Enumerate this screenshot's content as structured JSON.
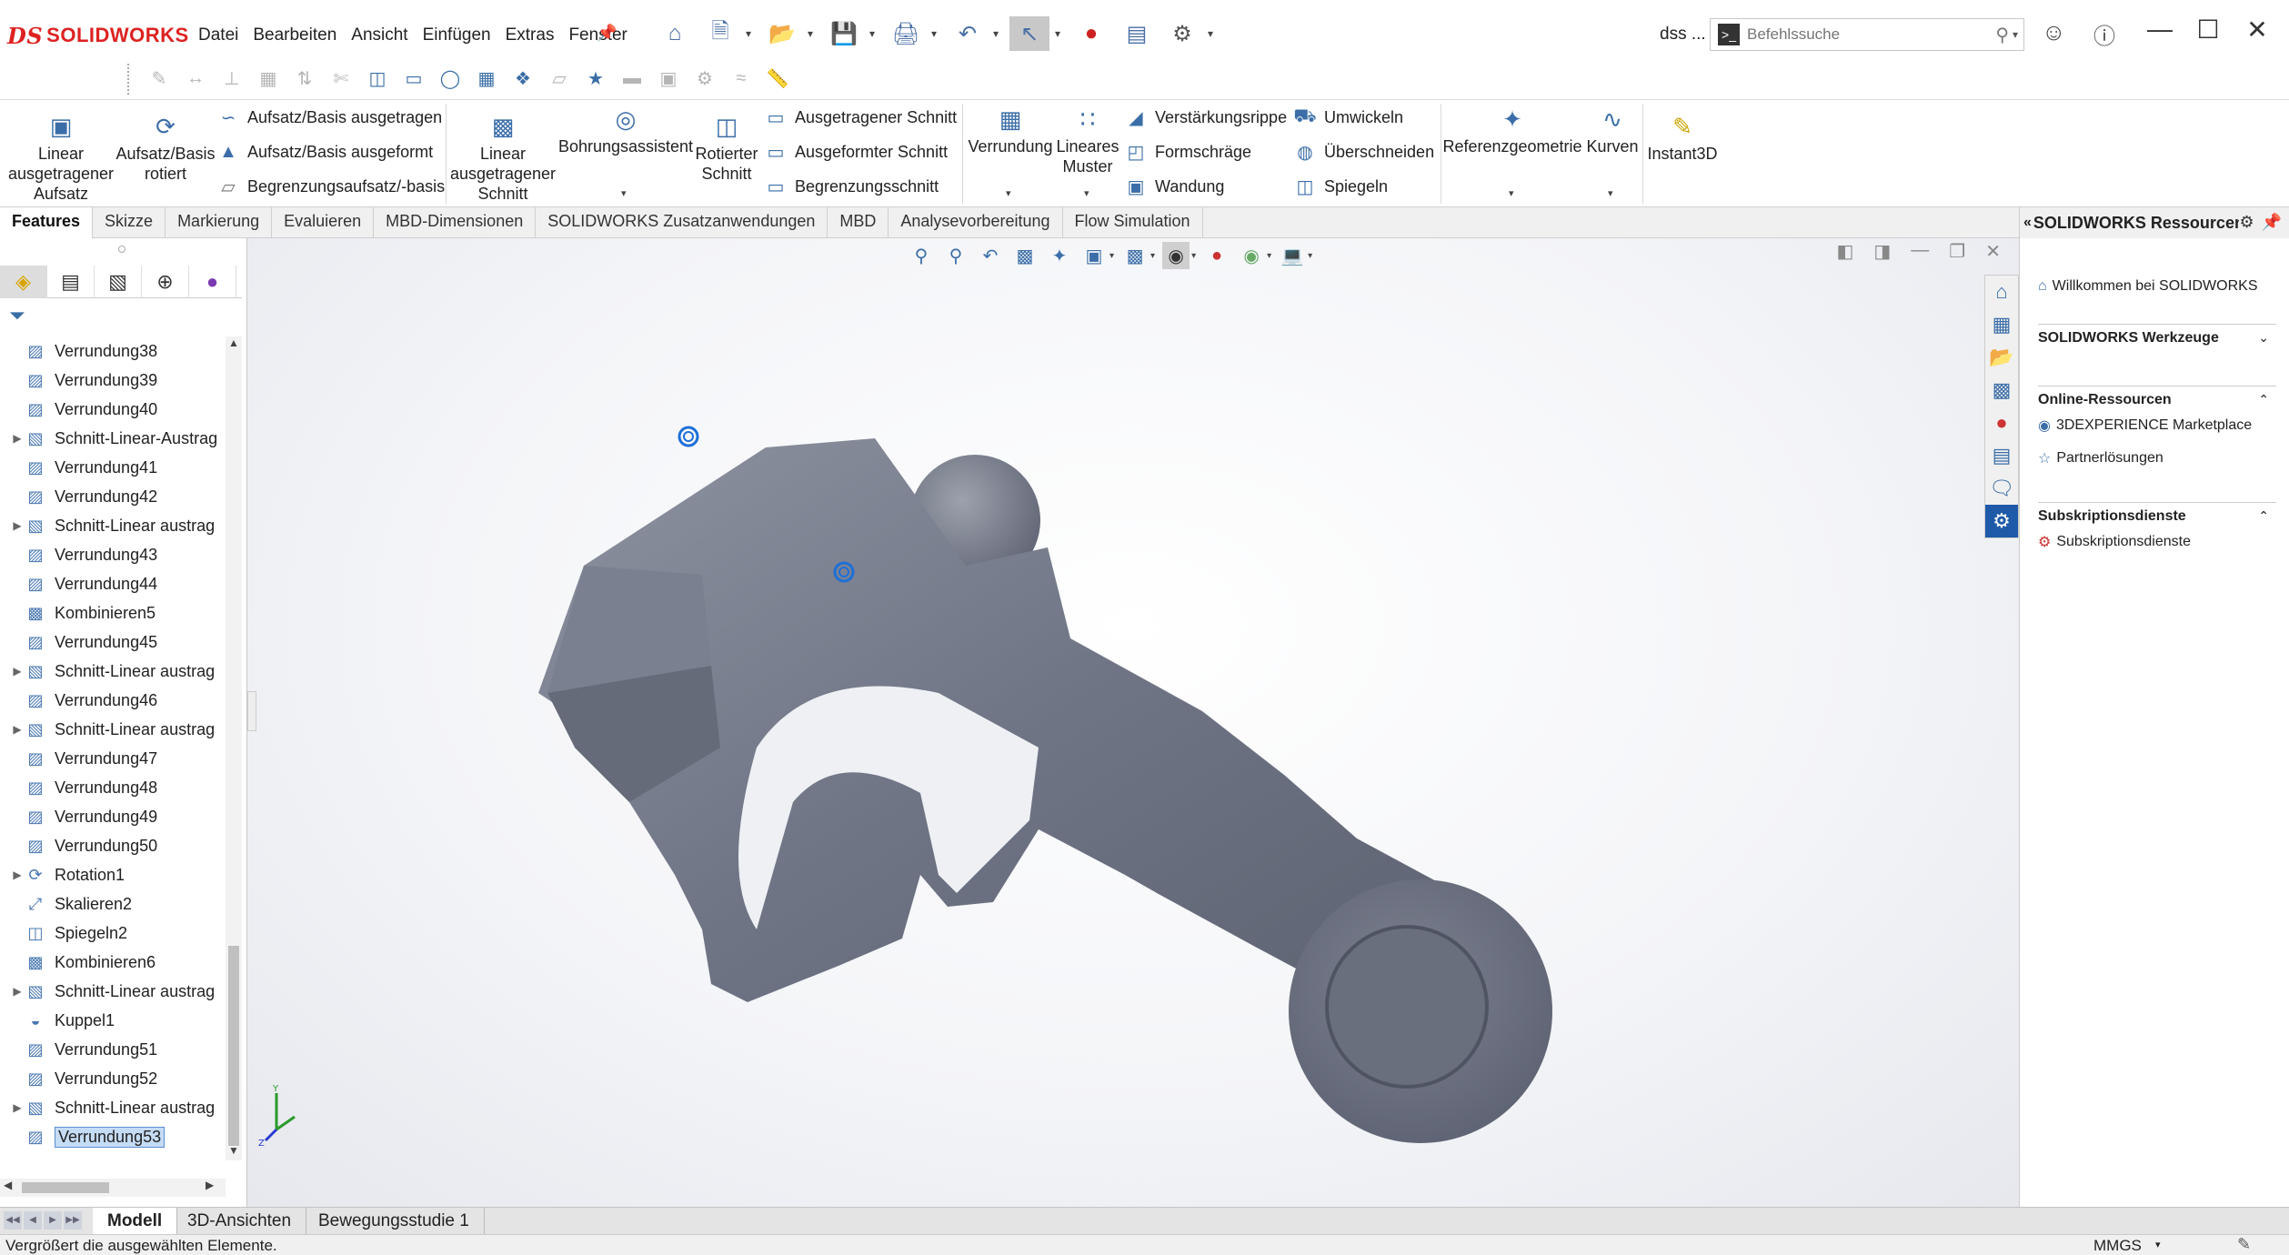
{
  "app": {
    "logo_text": "SOLIDWORKS",
    "menu": [
      "Datei",
      "Bearbeiten",
      "Ansicht",
      "Einfügen",
      "Extras",
      "Fenster"
    ],
    "user_label": "dss ...",
    "search": {
      "placeholder": "Befehlssuche"
    }
  },
  "ribbon": {
    "linear_extrude": "Linear ausgetragener Aufsatz",
    "revolve": "Aufsatz/Basis rotiert",
    "sweep": "Aufsatz/Basis ausgetragen",
    "loft": "Aufsatz/Basis ausgeformt",
    "boundary": "Begrenzungsaufsatz/-basis",
    "extruded_cut": "Linear ausgetragener Schnitt",
    "hole_wizard": "Bohrungsassistent",
    "revolved_cut": "Rotierter Schnitt",
    "swept_cut": "Ausgetragener Schnitt",
    "lofted_cut": "Ausgeformter Schnitt",
    "boundary_cut": "Begrenzungsschnitt",
    "fillet": "Verrundung",
    "linear_pattern": "Lineares Muster",
    "rib": "Verstärkungsrippe",
    "draft": "Formschräge",
    "shell": "Wandung",
    "wrap": "Umwickeln",
    "intersect": "Überschneiden",
    "mirror": "Spiegeln",
    "ref_geometry": "Referenzgeometrie",
    "curves": "Kurven",
    "instant3d": "Instant3D"
  },
  "tabs": [
    "Features",
    "Skizze",
    "Markierung",
    "Evaluieren",
    "MBD-Dimensionen",
    "SOLIDWORKS Zusatzanwendungen",
    "MBD",
    "Analysevorbereitung",
    "Flow Simulation"
  ],
  "active_tab": "Features",
  "tree": [
    {
      "label": "Verrundung38",
      "icon": "fillet-feature-icon",
      "expandable": false
    },
    {
      "label": "Verrundung39",
      "icon": "fillet-feature-icon",
      "expandable": false
    },
    {
      "label": "Verrundung40",
      "icon": "fillet-feature-icon",
      "expandable": false
    },
    {
      "label": "Schnitt-Linear-Austrag",
      "icon": "cut-extrude-feature-icon",
      "expandable": true
    },
    {
      "label": "Verrundung41",
      "icon": "fillet-feature-icon",
      "expandable": false
    },
    {
      "label": "Verrundung42",
      "icon": "fillet-feature-icon",
      "expandable": false
    },
    {
      "label": "Schnitt-Linear austrag",
      "icon": "cut-extrude-feature-icon",
      "expandable": true
    },
    {
      "label": "Verrundung43",
      "icon": "fillet-feature-icon",
      "expandable": false
    },
    {
      "label": "Verrundung44",
      "icon": "fillet-feature-icon",
      "expandable": false
    },
    {
      "label": "Kombinieren5",
      "icon": "combine-feature-icon",
      "expandable": false
    },
    {
      "label": "Verrundung45",
      "icon": "fillet-feature-icon",
      "expandable": false
    },
    {
      "label": "Schnitt-Linear austrag",
      "icon": "cut-extrude-feature-icon",
      "expandable": true
    },
    {
      "label": "Verrundung46",
      "icon": "fillet-feature-icon",
      "expandable": false
    },
    {
      "label": "Schnitt-Linear austrag",
      "icon": "cut-extrude-feature-icon",
      "expandable": true
    },
    {
      "label": "Verrundung47",
      "icon": "fillet-feature-icon",
      "expandable": false
    },
    {
      "label": "Verrundung48",
      "icon": "fillet-feature-icon",
      "expandable": false
    },
    {
      "label": "Verrundung49",
      "icon": "fillet-feature-icon",
      "expandable": false
    },
    {
      "label": "Verrundung50",
      "icon": "fillet-feature-icon",
      "expandable": false
    },
    {
      "label": "Rotation1",
      "icon": "revolve-feature-icon",
      "expandable": true
    },
    {
      "label": "Skalieren2",
      "icon": "scale-feature-icon",
      "expandable": false
    },
    {
      "label": "Spiegeln2",
      "icon": "mirror-feature-icon",
      "expandable": false
    },
    {
      "label": "Kombinieren6",
      "icon": "combine-feature-icon",
      "expandable": false
    },
    {
      "label": "Schnitt-Linear austrag",
      "icon": "cut-extrude-feature-icon",
      "expandable": true
    },
    {
      "label": "Kuppel1",
      "icon": "dome-feature-icon",
      "expandable": false
    },
    {
      "label": "Verrundung51",
      "icon": "fillet-feature-icon",
      "expandable": false
    },
    {
      "label": "Verrundung52",
      "icon": "fillet-feature-icon",
      "expandable": false
    },
    {
      "label": "Schnitt-Linear austrag",
      "icon": "cut-extrude-feature-icon",
      "expandable": true
    },
    {
      "label": "Verrundung53",
      "icon": "fillet-feature-icon",
      "expandable": false,
      "selected": true
    }
  ],
  "taskpane": {
    "title": "SOLIDWORKS Ressourcen",
    "welcome": "Willkommen bei SOLIDWORKS",
    "tools_header": "SOLIDWORKS Werkzeuge",
    "online_header": "Online-Ressourcen",
    "marketplace": "3DEXPERIENCE Marketplace",
    "partners": "Partnerlösungen",
    "subs_header": "Subskriptionsdienste",
    "subs_link": "Subskriptionsdienste"
  },
  "bottom_tabs": [
    "Modell",
    "3D-Ansichten",
    "Bewegungsstudie 1"
  ],
  "status": {
    "message": "Vergrößert die ausgewählten Elemente.",
    "units": "MMGS"
  },
  "colors": {
    "model_body": "#6f7585",
    "model_highlight": "#9aa0ad",
    "selection_blue": "#1e6fd9",
    "brand_red": "#dd2222"
  }
}
